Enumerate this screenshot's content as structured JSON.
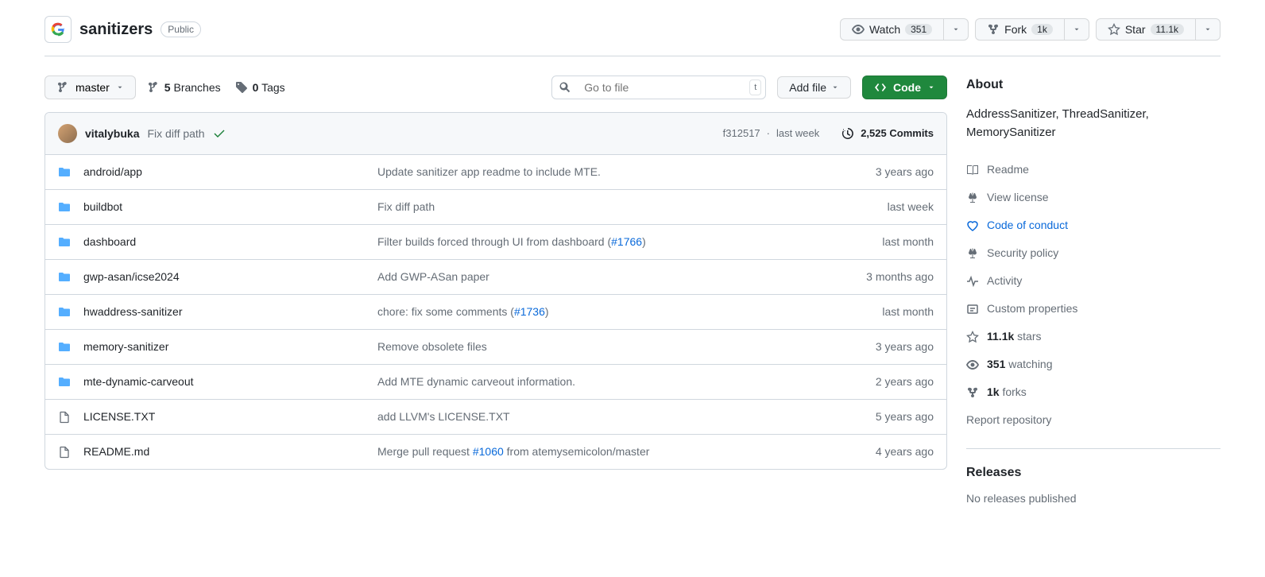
{
  "repo": {
    "name": "sanitizers",
    "visibility": "Public"
  },
  "actions": {
    "watch": {
      "label": "Watch",
      "count": "351"
    },
    "fork": {
      "label": "Fork",
      "count": "1k"
    },
    "star": {
      "label": "Star",
      "count": "11.1k"
    }
  },
  "toolbar": {
    "branch": "master",
    "branches_count": "5",
    "branches_label": "Branches",
    "tags_count": "0",
    "tags_label": "Tags",
    "search_placeholder": "Go to file",
    "kbd_hint": "t",
    "add_file": "Add file",
    "code": "Code"
  },
  "commit": {
    "author": "vitalybuka",
    "message": "Fix diff path",
    "sha": "f312517",
    "date": "last week",
    "count": "2,525",
    "count_suffix": "Commits"
  },
  "files": [
    {
      "type": "dir",
      "name": "android/app",
      "msg": "Update sanitizer app readme to include MTE.",
      "date": "3 years ago"
    },
    {
      "type": "dir",
      "name": "buildbot",
      "msg": "Fix diff path",
      "date": "last week"
    },
    {
      "type": "dir",
      "name": "dashboard",
      "msg_prefix": "Filter builds forced through UI from dashboard (",
      "link": "#1766",
      "msg_suffix": ")",
      "date": "last month"
    },
    {
      "type": "dir",
      "name": "gwp-asan/icse2024",
      "msg": "Add GWP-ASan paper",
      "date": "3 months ago"
    },
    {
      "type": "dir",
      "name": "hwaddress-sanitizer",
      "msg_prefix": "chore: fix some comments (",
      "link": "#1736",
      "msg_suffix": ")",
      "date": "last month"
    },
    {
      "type": "dir",
      "name": "memory-sanitizer",
      "msg": "Remove obsolete files",
      "date": "3 years ago"
    },
    {
      "type": "dir",
      "name": "mte-dynamic-carveout",
      "msg": "Add MTE dynamic carveout information.",
      "date": "2 years ago"
    },
    {
      "type": "file",
      "name": "LICENSE.TXT",
      "msg": "add LLVM's LICENSE.TXT",
      "date": "5 years ago"
    },
    {
      "type": "file",
      "name": "README.md",
      "msg_prefix": "Merge pull request ",
      "link": "#1060",
      "msg_suffix": " from atemysemicolon/master",
      "date": "4 years ago"
    }
  ],
  "about": {
    "title": "About",
    "description": "AddressSanitizer, ThreadSanitizer, MemorySanitizer",
    "items": {
      "readme": "Readme",
      "license": "View license",
      "coc": "Code of conduct",
      "security": "Security policy",
      "activity": "Activity",
      "custom": "Custom properties",
      "stars_count": "11.1k",
      "stars_label": "stars",
      "watching_count": "351",
      "watching_label": "watching",
      "forks_count": "1k",
      "forks_label": "forks"
    },
    "report": "Report repository"
  },
  "releases": {
    "title": "Releases",
    "empty": "No releases published"
  }
}
